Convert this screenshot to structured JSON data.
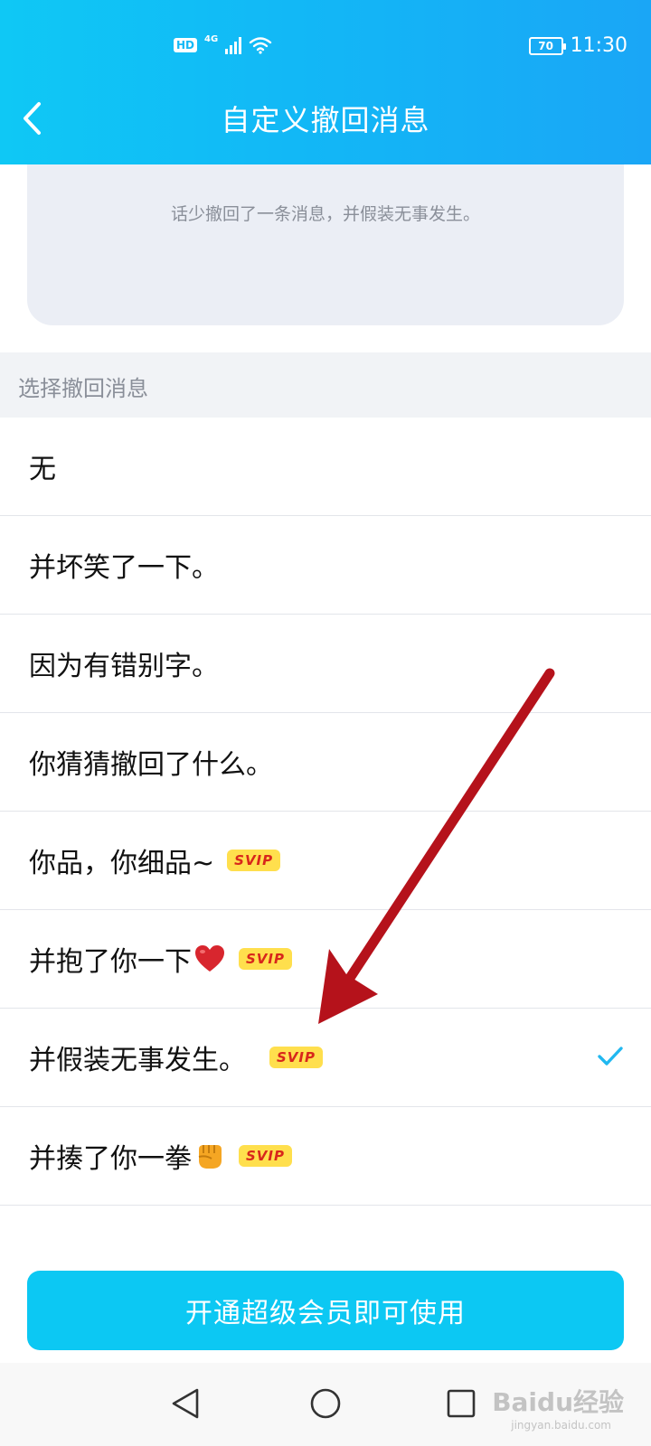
{
  "status_bar": {
    "hd": "HD",
    "network": "4G",
    "battery": "70",
    "time": "11:30",
    "icons": [
      "hd-icon",
      "signal-icon",
      "wifi-icon",
      "battery-icon"
    ]
  },
  "header": {
    "title": "自定义撤回消息",
    "back_icon": "chevron-left-icon"
  },
  "preview": {
    "text": "话少撤回了一条消息，并假装无事发生。"
  },
  "section": {
    "label": "选择撤回消息"
  },
  "options": [
    {
      "label": "无",
      "svip": false,
      "selected": false
    },
    {
      "label": "并坏笑了一下。",
      "svip": false,
      "selected": false
    },
    {
      "label": "因为有错别字。",
      "svip": false,
      "selected": false
    },
    {
      "label": "你猜猜撤回了什么。",
      "svip": false,
      "selected": false
    },
    {
      "label": "你品，你细品~",
      "svip": true,
      "selected": false
    },
    {
      "label": "并抱了你一下",
      "emoji": "heart-icon",
      "svip": true,
      "selected": false
    },
    {
      "label": "并假装无事发生。",
      "svip": true,
      "selected": true
    },
    {
      "label": "并揍了你一拳",
      "emoji": "fist-icon",
      "svip": true,
      "selected": false
    }
  ],
  "svip_badge": "SVIP",
  "cta": {
    "label": "开通超级会员即可使用"
  },
  "nav": {
    "icons": [
      "back-triangle-icon",
      "home-circle-icon",
      "recents-square-icon"
    ]
  },
  "watermark": {
    "brand": "Baidu经验",
    "url": "jingyan.baidu.com"
  },
  "colors": {
    "header_gradient_start": "#0fc8f5",
    "header_gradient_end": "#1aa6f6",
    "cta": "#0cc8f3",
    "check": "#21b8f0",
    "svip_bg": "#ffdf4d",
    "svip_text": "#d8261b",
    "annotation_arrow": "#b5121b"
  }
}
